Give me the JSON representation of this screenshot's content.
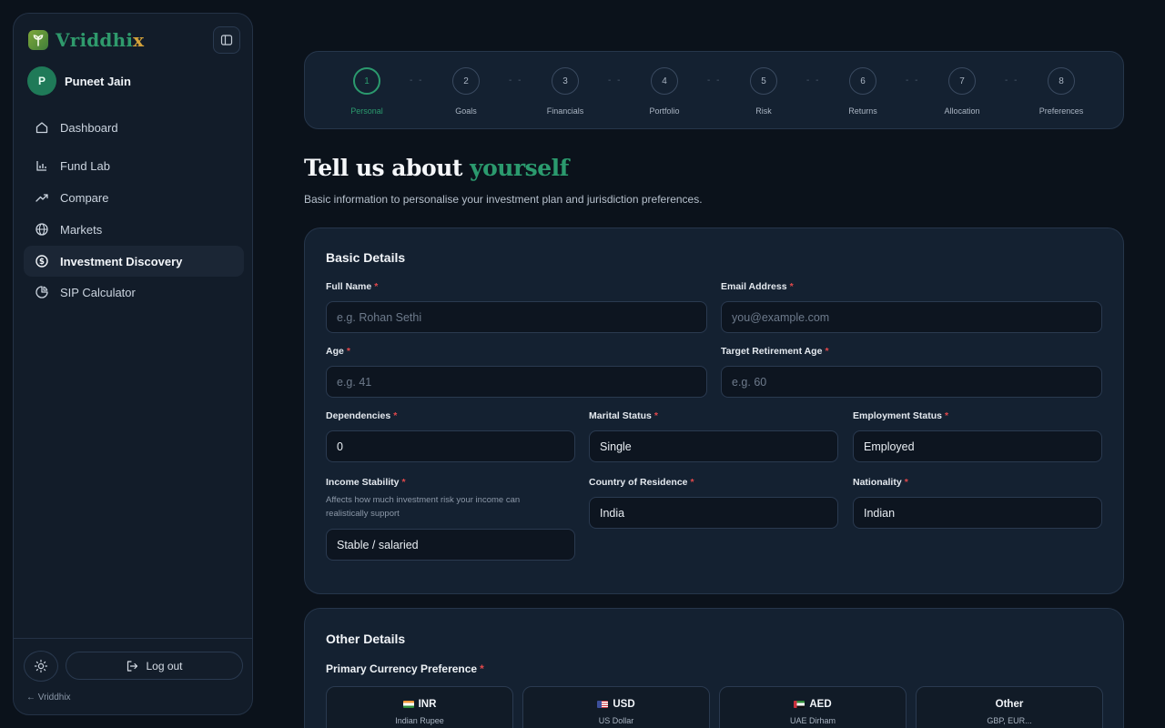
{
  "brand": {
    "name": "Vriddhi",
    "name_x": "x"
  },
  "user": {
    "initial": "P",
    "name": "Puneet Jain"
  },
  "nav": {
    "dashboard": "Dashboard",
    "fund_lab": "Fund Lab",
    "compare": "Compare",
    "markets": "Markets",
    "investment_discovery": "Investment Discovery",
    "sip_calculator": "SIP Calculator"
  },
  "footer": {
    "logout": "Log out",
    "back": "← Vriddhix"
  },
  "steps": [
    {
      "num": "1",
      "label": "Personal"
    },
    {
      "num": "2",
      "label": "Goals"
    },
    {
      "num": "3",
      "label": "Financials"
    },
    {
      "num": "4",
      "label": "Portfolio"
    },
    {
      "num": "5",
      "label": "Risk"
    },
    {
      "num": "6",
      "label": "Returns"
    },
    {
      "num": "7",
      "label": "Allocation"
    },
    {
      "num": "8",
      "label": "Preferences"
    }
  ],
  "step_separator": "- -",
  "page": {
    "title_main": "Tell us about",
    "title_accent": "yourself",
    "subtitle": "Basic information to personalise your investment plan and jurisdiction preferences."
  },
  "basic": {
    "title": "Basic Details",
    "required_mark": "*",
    "full_name": {
      "label": "Full Name",
      "placeholder": "e.g. Rohan Sethi"
    },
    "email": {
      "label": "Email Address",
      "placeholder": "you@example.com"
    },
    "age": {
      "label": "Age",
      "placeholder": "e.g. 41"
    },
    "retirement_age": {
      "label": "Target Retirement Age",
      "placeholder": "e.g. 60"
    },
    "dependencies": {
      "label": "Dependencies",
      "value": "0"
    },
    "marital_status": {
      "label": "Marital Status",
      "value": "Single"
    },
    "employment_status": {
      "label": "Employment Status",
      "value": "Employed"
    },
    "income_stability": {
      "label": "Income Stability",
      "help": "Affects how much investment risk your income can realistically support",
      "value": "Stable / salaried"
    },
    "country": {
      "label": "Country of Residence",
      "value": "India"
    },
    "nationality": {
      "label": "Nationality",
      "value": "Indian"
    }
  },
  "other": {
    "title": "Other Details",
    "currency_label": "Primary Currency Preference",
    "currencies": [
      {
        "code": "INR",
        "name": "Indian Rupee"
      },
      {
        "code": "USD",
        "name": "US Dollar"
      },
      {
        "code": "AED",
        "name": "UAE Dirham"
      },
      {
        "code": "Other",
        "name": "GBP, EUR..."
      }
    ]
  },
  "colors": {
    "accent": "#2b9a6e",
    "required": "#e0484b",
    "brand_x": "#d4a23a",
    "background": "#0b121b",
    "card": "#142131"
  }
}
